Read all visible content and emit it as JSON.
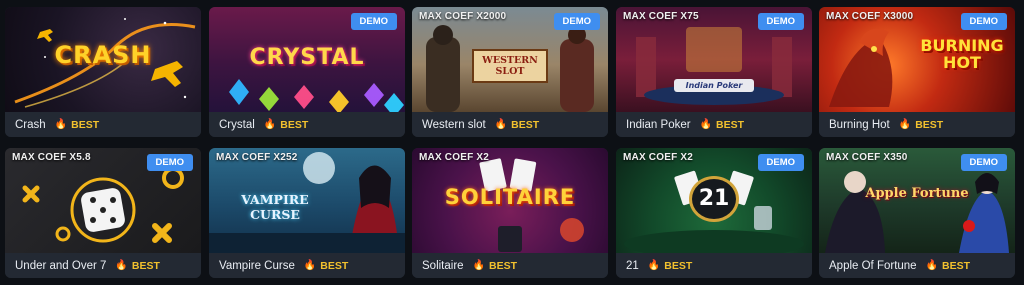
{
  "badge_best": "BEST",
  "badge_demo": "DEMO",
  "games": [
    {
      "title": "Crash",
      "coef": "",
      "demo": false,
      "logo": "CRASH"
    },
    {
      "title": "Crystal",
      "coef": "",
      "demo": true,
      "logo": "CRYSTAL"
    },
    {
      "title": "Western slot",
      "coef": "MAX COEF X2000",
      "demo": true,
      "logo": "WESTERN SLOT"
    },
    {
      "title": "Indian Poker",
      "coef": "MAX COEF X75",
      "demo": true,
      "logo": "Indian Poker"
    },
    {
      "title": "Burning Hot",
      "coef": "MAX COEF X3000",
      "demo": true,
      "logo": "BURNING HOT"
    },
    {
      "title": "Under and Over 7",
      "coef": "MAX COEF X5.8",
      "demo": true,
      "logo": ""
    },
    {
      "title": "Vampire Curse",
      "coef": "MAX COEF X252",
      "demo": false,
      "logo": "VAMPIRE CURSE"
    },
    {
      "title": "Solitaire",
      "coef": "MAX COEF X2",
      "demo": false,
      "logo": "SOLITAIRE"
    },
    {
      "title": "21",
      "coef": "MAX COEF X2",
      "demo": true,
      "logo": "21"
    },
    {
      "title": "Apple Of Fortune",
      "coef": "MAX COEF X350",
      "demo": true,
      "logo": "Apple Fortune"
    }
  ]
}
